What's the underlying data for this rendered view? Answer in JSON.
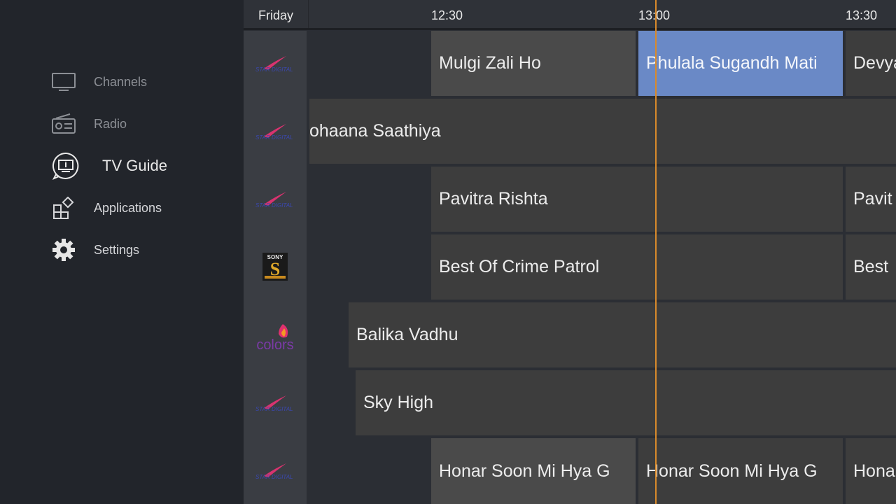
{
  "sidebar": {
    "items": [
      {
        "label": "Channels",
        "icon": "tv-icon"
      },
      {
        "label": "Radio",
        "icon": "radio-icon"
      },
      {
        "label": "TV Guide",
        "icon": "tv-guide-icon"
      },
      {
        "label": "Applications",
        "icon": "apps-icon"
      },
      {
        "label": "Settings",
        "icon": "gear-icon"
      }
    ],
    "active": "TV Guide"
  },
  "guide": {
    "day": "Friday",
    "times": [
      "12:30",
      "13:00",
      "13:30"
    ],
    "now_line_color": "#d98a2b",
    "selected_color": "#6a89c6",
    "rows": [
      {
        "channel_logo": "star-digital-logo",
        "programs": [
          "Mulgi Zali Ho",
          "Phulala Sugandh Mati",
          "Devya"
        ]
      },
      {
        "channel_logo": "star-digital-logo",
        "programs": [
          "ohaana Saathiya"
        ]
      },
      {
        "channel_logo": "star-digital-logo",
        "programs": [
          "Pavitra Rishta",
          "Pavit"
        ]
      },
      {
        "channel_logo": "sony-logo",
        "programs": [
          "Best Of Crime Patrol",
          "Best"
        ]
      },
      {
        "channel_logo": "colors-logo",
        "programs": [
          "Balika Vadhu"
        ]
      },
      {
        "channel_logo": "star-digital-logo",
        "programs": [
          "Sky High"
        ]
      },
      {
        "channel_logo": "star-digital-logo",
        "programs": [
          "Honar Soon Mi Hya G",
          "Honar Soon Mi Hya G",
          "Hona"
        ]
      }
    ]
  }
}
